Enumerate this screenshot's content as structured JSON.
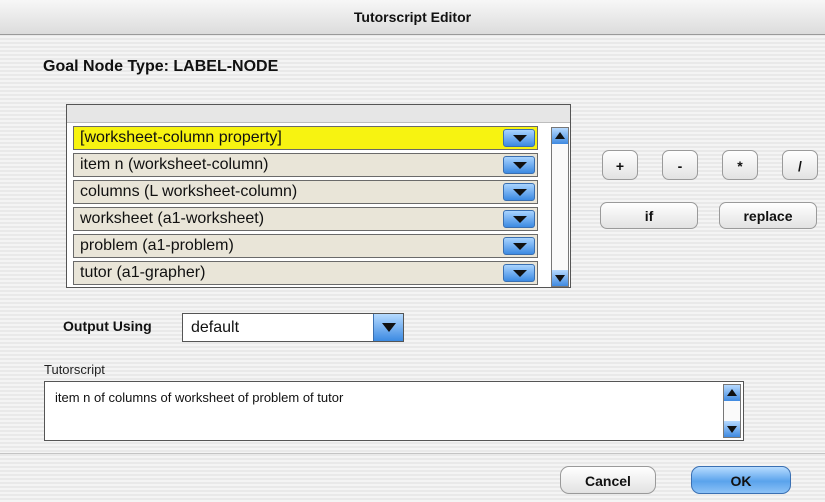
{
  "window": {
    "title": "Tutorscript Editor"
  },
  "goal_node": {
    "text": "Goal Node Type:  LABEL-NODE"
  },
  "list": {
    "items": [
      {
        "label": "[worksheet-column property]",
        "selected": true
      },
      {
        "label": "item n (worksheet-column)",
        "selected": false
      },
      {
        "label": "columns (L worksheet-column)",
        "selected": false
      },
      {
        "label": "worksheet (a1-worksheet)",
        "selected": false
      },
      {
        "label": "problem (a1-problem)",
        "selected": false
      },
      {
        "label": "tutor (a1-grapher)",
        "selected": false
      }
    ]
  },
  "operators": {
    "plus": "+",
    "minus": "-",
    "multiply": "*",
    "divide": "/"
  },
  "actions": {
    "if": "if",
    "replace": "replace"
  },
  "output": {
    "label": "Output Using",
    "value": "default"
  },
  "tutorscript": {
    "label": "Tutorscript",
    "value": "item n of columns of worksheet of problem of tutor"
  },
  "footer": {
    "cancel": "Cancel",
    "ok": "OK"
  },
  "colors": {
    "selection_highlight": "#f7f311",
    "row_background": "#e9e5d8",
    "aqua_blue": "#3c8ae2"
  }
}
